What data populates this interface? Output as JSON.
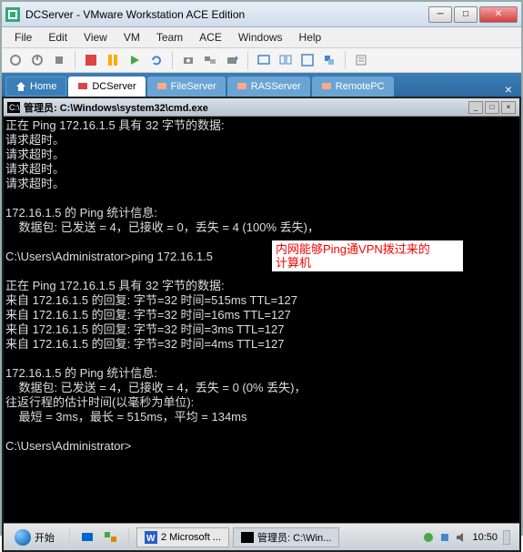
{
  "window": {
    "title": "DCServer - VMware Workstation ACE Edition"
  },
  "menu": {
    "file": "File",
    "edit": "Edit",
    "view": "View",
    "vm": "VM",
    "team": "Team",
    "ace": "ACE",
    "windows": "Windows",
    "help": "Help"
  },
  "tabs": {
    "home": "Home",
    "dcserver": "DCServer",
    "fileserver": "FileServer",
    "rasserver": "RASServer",
    "remotepc": "RemotePC"
  },
  "cmd": {
    "title": "管理员: C:\\Windows\\system32\\cmd.exe"
  },
  "terminal": {
    "text": "正在 Ping 172.16.1.5 具有 32 字节的数据:\n请求超时。\n请求超时。\n请求超时。\n请求超时。\n\n172.16.1.5 的 Ping 统计信息:\n    数据包: 已发送 = 4，已接收 = 0，丢失 = 4 (100% 丢失)，\n\nC:\\Users\\Administrator>ping 172.16.1.5\n\n正在 Ping 172.16.1.5 具有 32 字节的数据:\n来自 172.16.1.5 的回复: 字节=32 时间=515ms TTL=127\n来自 172.16.1.5 的回复: 字节=32 时间=16ms TTL=127\n来自 172.16.1.5 的回复: 字节=32 时间=3ms TTL=127\n来自 172.16.1.5 的回复: 字节=32 时间=4ms TTL=127\n\n172.16.1.5 的 Ping 统计信息:\n    数据包: 已发送 = 4，已接收 = 4，丢失 = 0 (0% 丢失)，\n往返行程的估计时间(以毫秒为单位):\n    最短 = 3ms，最长 = 515ms，平均 = 134ms\n\nC:\\Users\\Administrator>"
  },
  "annotation": {
    "text": "内网能够Ping通VPN拨过来的\n计算机"
  },
  "taskbar": {
    "start": "开始",
    "item1": "2 Microsoft ...",
    "item2": "管理员: C:\\Win...",
    "time": "10:50"
  }
}
